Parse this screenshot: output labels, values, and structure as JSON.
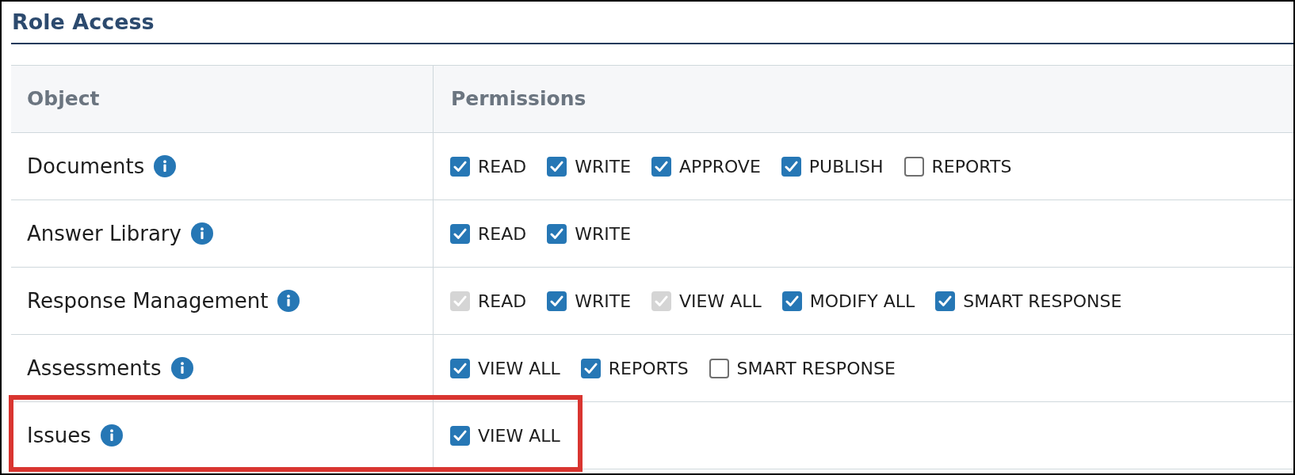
{
  "title": "Role Access",
  "table": {
    "columns": [
      "Object",
      "Permissions"
    ],
    "rows": [
      {
        "object": "Documents",
        "highlighted": false,
        "permissions": [
          {
            "label": "READ",
            "checked": true,
            "disabled": false
          },
          {
            "label": "WRITE",
            "checked": true,
            "disabled": false
          },
          {
            "label": "APPROVE",
            "checked": true,
            "disabled": false
          },
          {
            "label": "PUBLISH",
            "checked": true,
            "disabled": false
          },
          {
            "label": "REPORTS",
            "checked": false,
            "disabled": false
          }
        ]
      },
      {
        "object": "Answer Library",
        "highlighted": false,
        "permissions": [
          {
            "label": "READ",
            "checked": true,
            "disabled": false
          },
          {
            "label": "WRITE",
            "checked": true,
            "disabled": false
          }
        ]
      },
      {
        "object": "Response Management",
        "highlighted": false,
        "permissions": [
          {
            "label": "READ",
            "checked": true,
            "disabled": true
          },
          {
            "label": "WRITE",
            "checked": true,
            "disabled": false
          },
          {
            "label": "VIEW ALL",
            "checked": true,
            "disabled": true
          },
          {
            "label": "MODIFY ALL",
            "checked": true,
            "disabled": false
          },
          {
            "label": "SMART RESPONSE",
            "checked": true,
            "disabled": false
          }
        ]
      },
      {
        "object": "Assessments",
        "highlighted": false,
        "permissions": [
          {
            "label": "VIEW ALL",
            "checked": true,
            "disabled": false
          },
          {
            "label": "REPORTS",
            "checked": true,
            "disabled": false
          },
          {
            "label": "SMART RESPONSE",
            "checked": false,
            "disabled": false
          }
        ]
      },
      {
        "object": "Issues",
        "highlighted": true,
        "permissions": [
          {
            "label": "VIEW ALL",
            "checked": true,
            "disabled": false
          }
        ]
      }
    ]
  }
}
